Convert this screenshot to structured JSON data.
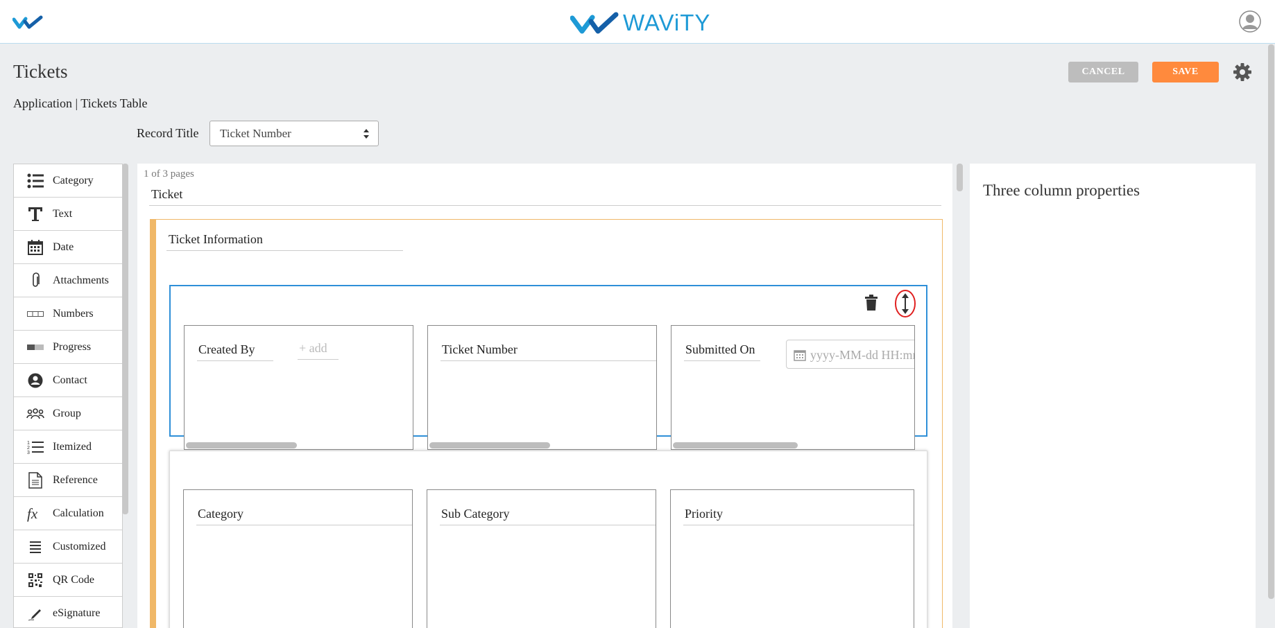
{
  "header": {
    "brand_name": "WAViTY",
    "logo_icon": "wavity-checkmarks-icon",
    "user_icon": "user-avatar-icon",
    "brand_color": "#1e9ad6"
  },
  "page": {
    "title": "Tickets",
    "breadcrumb": "Application | Tickets Table",
    "record_title_label": "Record Title",
    "record_title_value": "Ticket Number"
  },
  "actions": {
    "cancel_label": "CANCEL",
    "save_label": "SAVE",
    "save_color": "#ff8a3d",
    "cancel_color": "#bdbdbd"
  },
  "palette": {
    "items": [
      {
        "label": "Category",
        "icon": "list-icon"
      },
      {
        "label": "Text",
        "icon": "text-t-icon"
      },
      {
        "label": "Date",
        "icon": "calendar-icon"
      },
      {
        "label": "Attachments",
        "icon": "paperclip-icon"
      },
      {
        "label": "Numbers",
        "icon": "number-box-icon"
      },
      {
        "label": "Progress",
        "icon": "progress-bar-icon"
      },
      {
        "label": "Contact",
        "icon": "contact-icon"
      },
      {
        "label": "Group",
        "icon": "group-icon"
      },
      {
        "label": "Itemized",
        "icon": "numbered-list-icon"
      },
      {
        "label": "Reference",
        "icon": "document-icon"
      },
      {
        "label": "Calculation",
        "icon": "fx-icon"
      },
      {
        "label": "Customized",
        "icon": "lines-icon"
      },
      {
        "label": "QR Code",
        "icon": "qr-code-icon"
      },
      {
        "label": "eSignature",
        "icon": "pen-icon"
      }
    ]
  },
  "canvas": {
    "page_counter": "1 of 3 pages",
    "page_name": "Ticket",
    "section_title": "Ticket Information",
    "section_color": "#f0b868",
    "selected_row_color": "#2e8fd8",
    "row1": {
      "col1_label": "Created By",
      "col1_add": "+ add",
      "col2_label": "Ticket Number",
      "col3_label": "Submitted On",
      "col3_date_placeholder": "yyyy-MM-dd HH:mm"
    },
    "row2": {
      "col1_label": "Category",
      "col2_label": "Sub Category",
      "col3_label": "Priority"
    }
  },
  "properties": {
    "title": "Three column properties"
  }
}
